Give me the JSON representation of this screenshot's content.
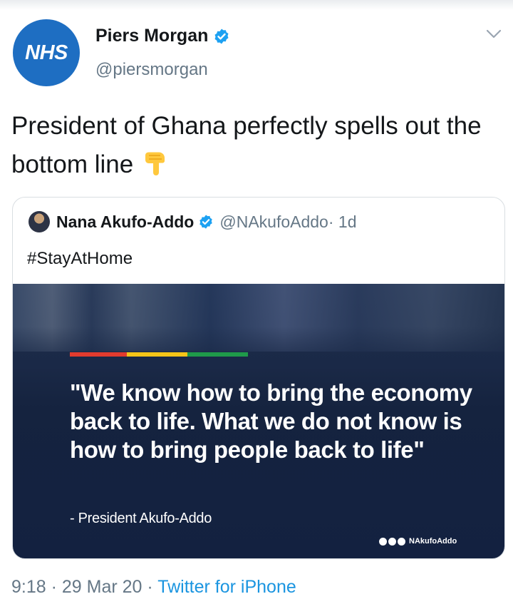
{
  "author": {
    "avatar_text": "NHS",
    "name": "Piers Morgan",
    "handle": "@piersmorgan",
    "verified_icon": "verified-badge-icon"
  },
  "tweet": {
    "text": "President of Ghana perfectly spells out the bottom line",
    "emoji": "backhand-index-pointing-down"
  },
  "quoted": {
    "name": "Nana Akufo-Addo",
    "handle": "@NAkufoAddo",
    "time": " · 1d",
    "hashtag": "#StayAtHome",
    "image": {
      "flag_colors": [
        "#e23b2e",
        "#f5c518",
        "#1f9a4a"
      ],
      "quote": "\"We know how to bring the economy back to life. What we do not know is how to bring people back to life\"",
      "attribution": "- President Akufo-Addo",
      "social_handle": "NAkufoAddo"
    }
  },
  "meta": {
    "time": "9:18",
    "date": "29 Mar 20",
    "separator": " · ",
    "source": "Twitter for iPhone"
  },
  "colors": {
    "accent": "#1b95e0",
    "nhs_blue": "#1e6ec2",
    "image_bg": "#15233f"
  }
}
